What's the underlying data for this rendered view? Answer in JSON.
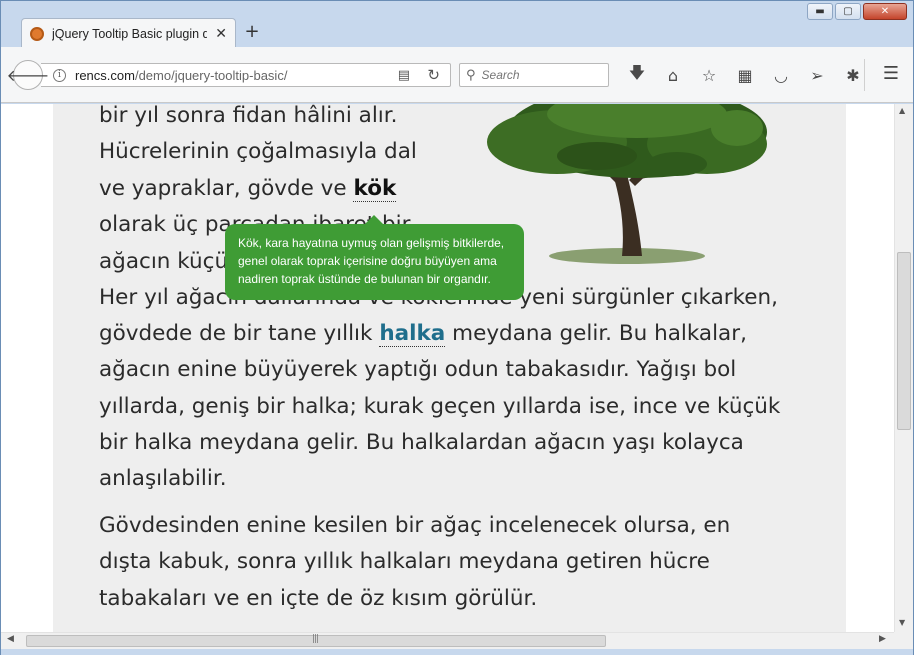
{
  "browser": {
    "tab_title": "jQuery Tooltip Basic plugin d",
    "tab_close": "✕",
    "new_tab": "+",
    "window_controls": {
      "minimize": "▬",
      "maximize": "▢",
      "close": "✕"
    },
    "url_host": "rencs.com",
    "url_path": "/demo/jquery-tooltip-basic/",
    "search_placeholder": "Search",
    "icons": [
      "back-icon",
      "info-icon",
      "reader-view-icon",
      "reload-icon",
      "search-icon",
      "download-icon",
      "home-icon",
      "bookmark-star-icon",
      "bookmarks-list-icon",
      "pocket-icon",
      "share-icon",
      "extension-icon",
      "menu-icon"
    ]
  },
  "article": {
    "p1_lines": [
      "bir yıl sonra fidan hâlini alır.",
      "Hücrelerinin çoğalmasıyla dal",
      "ve yapraklar, gövde ve ",
      "olarak üç parçadan ibaret bir",
      "ağacın küçük",
      "Her yıl ağacın dallarında ve köklerinde yeni sürgünler çıkarken,",
      "gövdede de bir tane yıllık ",
      " meydana gelir. Bu halkalar,",
      "ağacın enine büyüyerek yaptığı odun tabakasıdır. Yağışı bol",
      "yıllarda, geniş bir halka; kurak geçen yıllarda ise, ince ve küçük",
      "bir halka meydana gelir. Bu halkalardan ağacın yaşı kolayca",
      "anlaşılabilir."
    ],
    "term_kok": "kök",
    "term_halka": "halka",
    "p2_lines": [
      "Gövdesinden enine kesilen bir ağaç incelenecek olursa, en",
      "dışta kabuk, sonra yıllık halkaları meydana getiren hücre",
      "tabakaları ve en içte de öz kısım görülür."
    ],
    "tooltip_text": "Kök, kara hayatına uymuş olan gelişmiş bitkilerde, genel olarak toprak içerisine doğru büyüyen ama nadiren toprak üstünde de bulunan bir organdır.",
    "tooltip_color": "#3f9c35",
    "term_halka_color": "#1f6e8c"
  }
}
